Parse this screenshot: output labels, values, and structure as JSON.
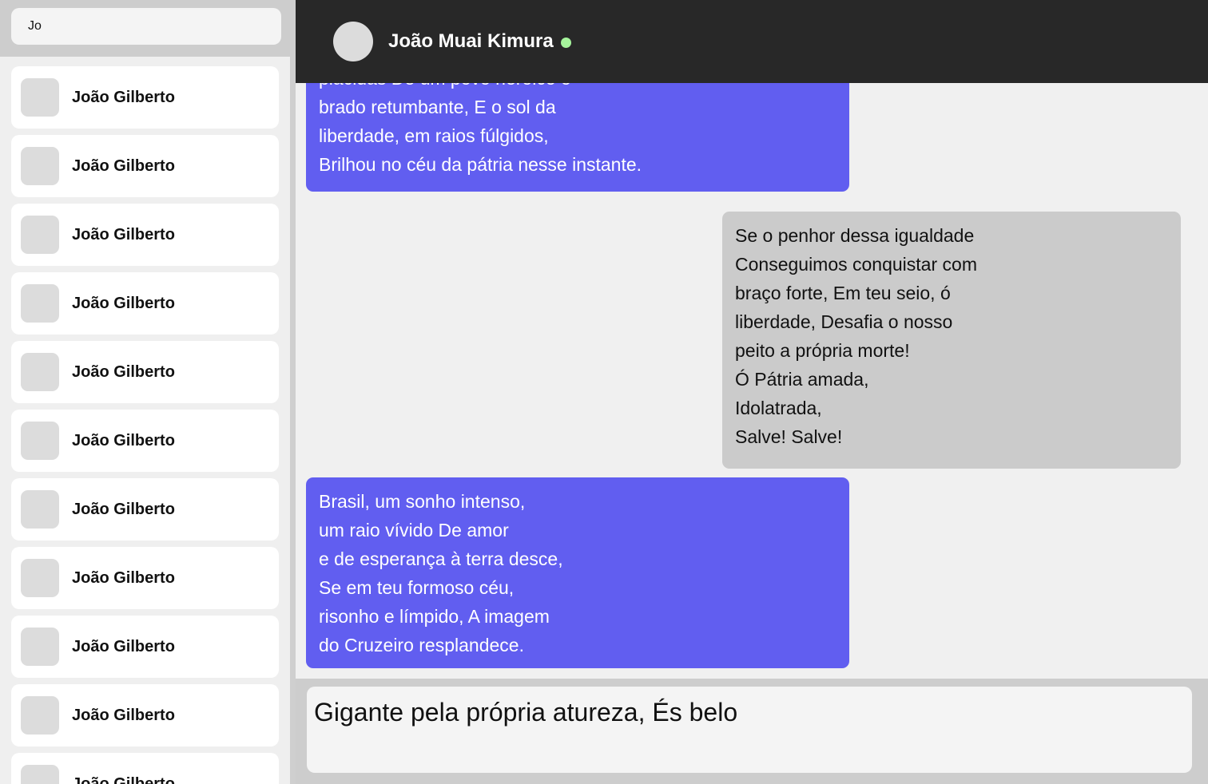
{
  "search": {
    "value": "Jo"
  },
  "contacts": [
    {
      "name": "João Gilberto"
    },
    {
      "name": "João Gilberto"
    },
    {
      "name": "João Gilberto"
    },
    {
      "name": "João Gilberto"
    },
    {
      "name": "João Gilberto"
    },
    {
      "name": "João Gilberto"
    },
    {
      "name": "João Gilberto"
    },
    {
      "name": "João Gilberto"
    },
    {
      "name": "João Gilberto"
    },
    {
      "name": "João Gilberto"
    },
    {
      "name": "João Gilberto"
    }
  ],
  "chat_header": {
    "name": "João Muai Kimura",
    "status": "online",
    "status_color": "#a6f59c"
  },
  "messages": [
    {
      "direction": "received",
      "lines": [
        "plácidas De um povo heróico o",
        "brado retumbante, E o sol da",
        "liberdade, em raios fúlgidos,",
        "Brilhou no céu da pátria nesse instante."
      ]
    },
    {
      "direction": "sent",
      "lines": [
        "Se o penhor dessa igualdade",
        "Conseguimos conquistar com",
        "braço forte, Em teu seio, ó",
        "liberdade, Desafia o nosso",
        "peito a própria morte!",
        "Ó Pátria amada,",
        "Idolatrada,",
        "Salve! Salve!"
      ]
    },
    {
      "direction": "received",
      "lines": [
        "Brasil, um sonho intenso,",
        "um raio vívido De amor",
        "e de esperança à terra desce,",
        "Se em teu formoso céu,",
        "risonho e límpido, A imagem",
        "do Cruzeiro resplandece."
      ]
    }
  ],
  "composer": {
    "value": "Gigante pela própria atureza, És belo"
  },
  "colors": {
    "received_bubble": "#615ef0",
    "sent_bubble": "#cbcbcb",
    "header_bg": "#282828"
  }
}
